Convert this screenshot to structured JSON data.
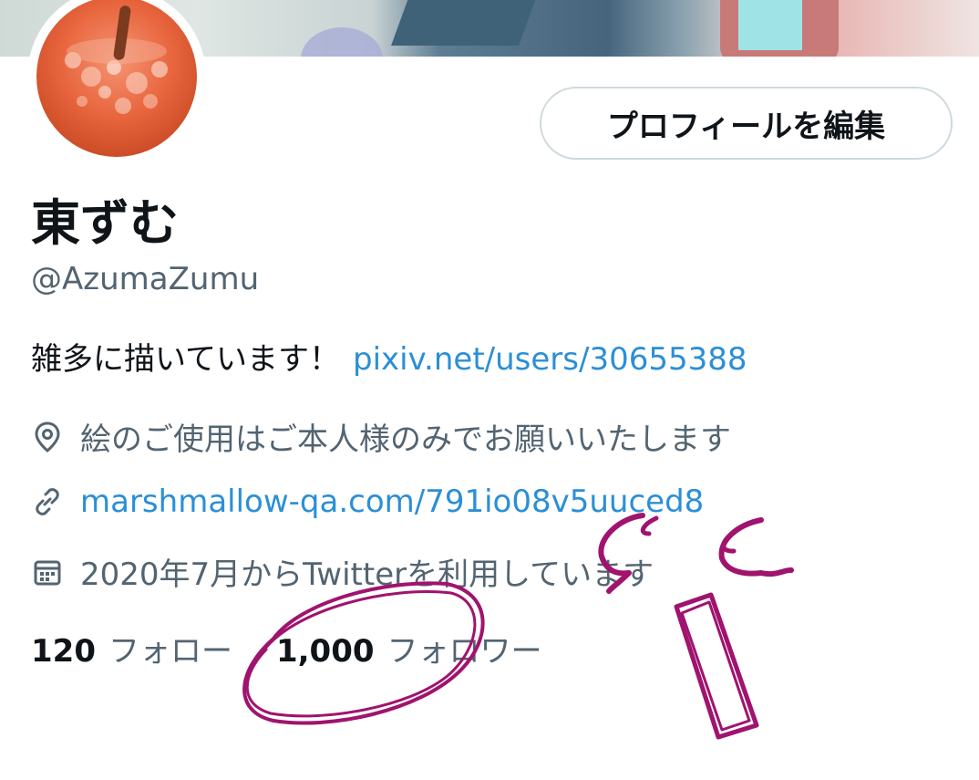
{
  "profile": {
    "edit_button": "プロフィールを編集",
    "display_name": "東ずむ",
    "handle": "@AzumaZumu",
    "bio_text": "雑多に描いています！",
    "bio_link": "pixiv.net/users/30655388",
    "location": "絵のご使用はご本人様のみでお願いいたします",
    "website": "marshmallow-qa.com/791io08v5uuced8",
    "joined": "2020年7月からTwitterを利用しています"
  },
  "stats": {
    "following_count": "120",
    "following_label": "フォロー",
    "followers_count": "1,000",
    "followers_label": "フォロワー"
  },
  "icons": [
    "location-pin-icon",
    "link-icon",
    "calendar-icon"
  ],
  "colors": {
    "link": "#2b8fd6",
    "secondary_text": "#536471",
    "annotation": "#a0136e"
  }
}
